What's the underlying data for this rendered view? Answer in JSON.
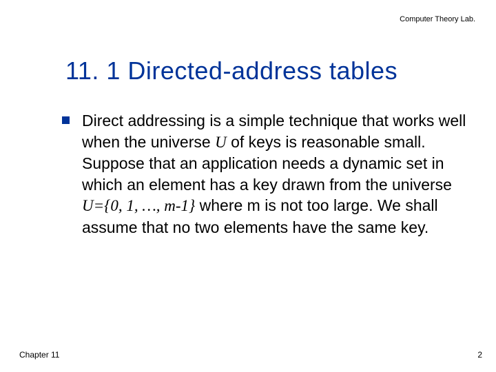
{
  "header": {
    "lab": "Computer Theory Lab."
  },
  "title": "11. 1  Directed-address tables",
  "body": {
    "t1": "Direct addressing is a simple technique that works well when the universe ",
    "u": "U",
    "t2": " of keys is reasonable small.  Suppose that an application needs a dynamic set in which an element has a key drawn from the universe ",
    "uset": "U={0, 1, …, m-1}",
    "t3": " where m is not too large.  We shall assume that no two elements have the same key."
  },
  "footer": {
    "left": "Chapter 11",
    "right": "2"
  }
}
